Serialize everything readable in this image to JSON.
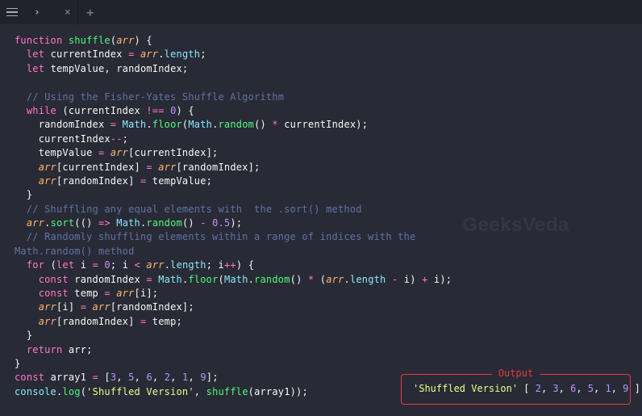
{
  "titlebar": {
    "tab_indicator": "›",
    "close_glyph": "×",
    "newtab_glyph": "+"
  },
  "watermark": "GeeksVeda",
  "output": {
    "label": "Output",
    "string_part": "'Shuffled Version'",
    "array_open": " [ ",
    "array_close": " ]",
    "values": [
      "2",
      "3",
      "6",
      "5",
      "1",
      "9"
    ]
  },
  "code": {
    "l1": {
      "a": "function ",
      "b": "shuffle",
      "c": "(",
      "d": "arr",
      "e": ") {"
    },
    "l2": {
      "a": "  ",
      "b": "let ",
      "c": "currentIndex ",
      "d": "= ",
      "e": "arr",
      "f": ".",
      "g": "length",
      "h": ";"
    },
    "l3": {
      "a": "  ",
      "b": "let ",
      "c": "tempValue",
      "d": ", ",
      "e": "randomIndex",
      "f": ";"
    },
    "l4": "",
    "l5": {
      "a": "  ",
      "b": "// Using the Fisher-Yates Shuffle Algorithm"
    },
    "l6": {
      "a": "  ",
      "b": "while ",
      "c": "(currentIndex ",
      "d": "!== ",
      "e": "0",
      "f": ") {"
    },
    "l7": {
      "a": "    randomIndex ",
      "b": "= ",
      "c": "Math",
      "d": ".",
      "e": "floor",
      "f": "(",
      "g": "Math",
      "h": ".",
      "i": "random",
      "j": "() ",
      "k": "* ",
      "l": "currentIndex);"
    },
    "l8": {
      "a": "    currentIndex",
      "b": "--",
      "c": ";"
    },
    "l9": {
      "a": "    tempValue ",
      "b": "= ",
      "c": "arr",
      "d": "[currentIndex];"
    },
    "l10": {
      "a": "    ",
      "b": "arr",
      "c": "[currentIndex] ",
      "d": "= ",
      "e": "arr",
      "f": "[randomIndex];"
    },
    "l11": {
      "a": "    ",
      "b": "arr",
      "c": "[randomIndex] ",
      "d": "= ",
      "e": "tempValue;"
    },
    "l12": {
      "a": "  }"
    },
    "l13": {
      "a": "  ",
      "b": "// Shuffling any equal elements with  the .sort() method"
    },
    "l14": {
      "a": "  ",
      "b": "arr",
      "c": ".",
      "d": "sort",
      "e": "(() ",
      "f": "=> ",
      "g": "Math",
      "h": ".",
      "i": "random",
      "j": "() ",
      "k": "- ",
      "l": "0.5",
      "m": ");"
    },
    "l15": {
      "a": "  ",
      "b": "// Randomly shuffling elements within a range of indices with the "
    },
    "l16": {
      "a": "Math.random() method"
    },
    "l17": {
      "a": "  ",
      "b": "for ",
      "c": "(",
      "d": "let ",
      "e": "i ",
      "f": "= ",
      "g": "0",
      "h": "; i ",
      "i": "< ",
      "j": "arr",
      "k": ".",
      "l": "length",
      "m": "; i",
      "n": "++",
      "o": ") {"
    },
    "l18": {
      "a": "    ",
      "b": "const ",
      "c": "randomIndex ",
      "d": "= ",
      "e": "Math",
      "f": ".",
      "g": "floor",
      "h": "(",
      "i": "Math",
      "j": ".",
      "k": "random",
      "l": "() ",
      "m": "* ",
      "n": "(",
      "o": "arr",
      "p": ".",
      "q": "length ",
      "r": "- ",
      "s": "i) ",
      "t": "+ ",
      "u": "i);"
    },
    "l19": {
      "a": "    ",
      "b": "const ",
      "c": "temp ",
      "d": "= ",
      "e": "arr",
      "f": "[i];"
    },
    "l20": {
      "a": "    ",
      "b": "arr",
      "c": "[i] ",
      "d": "= ",
      "e": "arr",
      "f": "[randomIndex];"
    },
    "l21": {
      "a": "    ",
      "b": "arr",
      "c": "[randomIndex] ",
      "d": "= ",
      "e": "temp;"
    },
    "l22": {
      "a": "  }"
    },
    "l23": {
      "a": "  ",
      "b": "return ",
      "c": "arr;"
    },
    "l24": {
      "a": "}"
    },
    "l25": {
      "a": "const ",
      "b": "array1 ",
      "c": "= ",
      "d": "[",
      "e": "3",
      "f": ", ",
      "g": "5",
      "h": ", ",
      "i": "6",
      "j": ", ",
      "k": "2",
      "l": ", ",
      "m": "1",
      "n": ", ",
      "o": "9",
      "p": "];"
    },
    "l26": {
      "a": "console",
      "b": ".",
      "c": "log",
      "d": "(",
      "e": "'Shuffled Version'",
      "f": ", ",
      "g": "shuffle",
      "h": "(array1));"
    }
  }
}
